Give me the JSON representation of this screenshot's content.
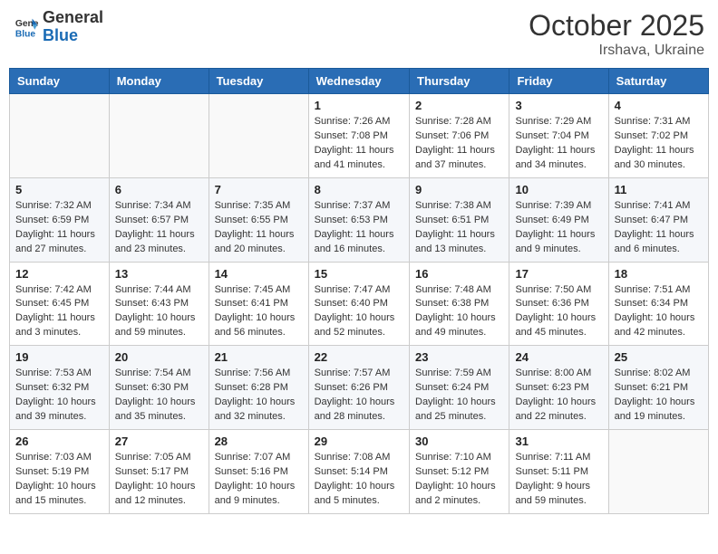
{
  "header": {
    "logo_line1": "General",
    "logo_line2": "Blue",
    "month": "October 2025",
    "location": "Irshava, Ukraine"
  },
  "weekdays": [
    "Sunday",
    "Monday",
    "Tuesday",
    "Wednesday",
    "Thursday",
    "Friday",
    "Saturday"
  ],
  "weeks": [
    [
      {
        "day": "",
        "info": ""
      },
      {
        "day": "",
        "info": ""
      },
      {
        "day": "",
        "info": ""
      },
      {
        "day": "1",
        "info": "Sunrise: 7:26 AM\nSunset: 7:08 PM\nDaylight: 11 hours and 41 minutes."
      },
      {
        "day": "2",
        "info": "Sunrise: 7:28 AM\nSunset: 7:06 PM\nDaylight: 11 hours and 37 minutes."
      },
      {
        "day": "3",
        "info": "Sunrise: 7:29 AM\nSunset: 7:04 PM\nDaylight: 11 hours and 34 minutes."
      },
      {
        "day": "4",
        "info": "Sunrise: 7:31 AM\nSunset: 7:02 PM\nDaylight: 11 hours and 30 minutes."
      }
    ],
    [
      {
        "day": "5",
        "info": "Sunrise: 7:32 AM\nSunset: 6:59 PM\nDaylight: 11 hours and 27 minutes."
      },
      {
        "day": "6",
        "info": "Sunrise: 7:34 AM\nSunset: 6:57 PM\nDaylight: 11 hours and 23 minutes."
      },
      {
        "day": "7",
        "info": "Sunrise: 7:35 AM\nSunset: 6:55 PM\nDaylight: 11 hours and 20 minutes."
      },
      {
        "day": "8",
        "info": "Sunrise: 7:37 AM\nSunset: 6:53 PM\nDaylight: 11 hours and 16 minutes."
      },
      {
        "day": "9",
        "info": "Sunrise: 7:38 AM\nSunset: 6:51 PM\nDaylight: 11 hours and 13 minutes."
      },
      {
        "day": "10",
        "info": "Sunrise: 7:39 AM\nSunset: 6:49 PM\nDaylight: 11 hours and 9 minutes."
      },
      {
        "day": "11",
        "info": "Sunrise: 7:41 AM\nSunset: 6:47 PM\nDaylight: 11 hours and 6 minutes."
      }
    ],
    [
      {
        "day": "12",
        "info": "Sunrise: 7:42 AM\nSunset: 6:45 PM\nDaylight: 11 hours and 3 minutes."
      },
      {
        "day": "13",
        "info": "Sunrise: 7:44 AM\nSunset: 6:43 PM\nDaylight: 10 hours and 59 minutes."
      },
      {
        "day": "14",
        "info": "Sunrise: 7:45 AM\nSunset: 6:41 PM\nDaylight: 10 hours and 56 minutes."
      },
      {
        "day": "15",
        "info": "Sunrise: 7:47 AM\nSunset: 6:40 PM\nDaylight: 10 hours and 52 minutes."
      },
      {
        "day": "16",
        "info": "Sunrise: 7:48 AM\nSunset: 6:38 PM\nDaylight: 10 hours and 49 minutes."
      },
      {
        "day": "17",
        "info": "Sunrise: 7:50 AM\nSunset: 6:36 PM\nDaylight: 10 hours and 45 minutes."
      },
      {
        "day": "18",
        "info": "Sunrise: 7:51 AM\nSunset: 6:34 PM\nDaylight: 10 hours and 42 minutes."
      }
    ],
    [
      {
        "day": "19",
        "info": "Sunrise: 7:53 AM\nSunset: 6:32 PM\nDaylight: 10 hours and 39 minutes."
      },
      {
        "day": "20",
        "info": "Sunrise: 7:54 AM\nSunset: 6:30 PM\nDaylight: 10 hours and 35 minutes."
      },
      {
        "day": "21",
        "info": "Sunrise: 7:56 AM\nSunset: 6:28 PM\nDaylight: 10 hours and 32 minutes."
      },
      {
        "day": "22",
        "info": "Sunrise: 7:57 AM\nSunset: 6:26 PM\nDaylight: 10 hours and 28 minutes."
      },
      {
        "day": "23",
        "info": "Sunrise: 7:59 AM\nSunset: 6:24 PM\nDaylight: 10 hours and 25 minutes."
      },
      {
        "day": "24",
        "info": "Sunrise: 8:00 AM\nSunset: 6:23 PM\nDaylight: 10 hours and 22 minutes."
      },
      {
        "day": "25",
        "info": "Sunrise: 8:02 AM\nSunset: 6:21 PM\nDaylight: 10 hours and 19 minutes."
      }
    ],
    [
      {
        "day": "26",
        "info": "Sunrise: 7:03 AM\nSunset: 5:19 PM\nDaylight: 10 hours and 15 minutes."
      },
      {
        "day": "27",
        "info": "Sunrise: 7:05 AM\nSunset: 5:17 PM\nDaylight: 10 hours and 12 minutes."
      },
      {
        "day": "28",
        "info": "Sunrise: 7:07 AM\nSunset: 5:16 PM\nDaylight: 10 hours and 9 minutes."
      },
      {
        "day": "29",
        "info": "Sunrise: 7:08 AM\nSunset: 5:14 PM\nDaylight: 10 hours and 5 minutes."
      },
      {
        "day": "30",
        "info": "Sunrise: 7:10 AM\nSunset: 5:12 PM\nDaylight: 10 hours and 2 minutes."
      },
      {
        "day": "31",
        "info": "Sunrise: 7:11 AM\nSunset: 5:11 PM\nDaylight: 9 hours and 59 minutes."
      },
      {
        "day": "",
        "info": ""
      }
    ]
  ]
}
